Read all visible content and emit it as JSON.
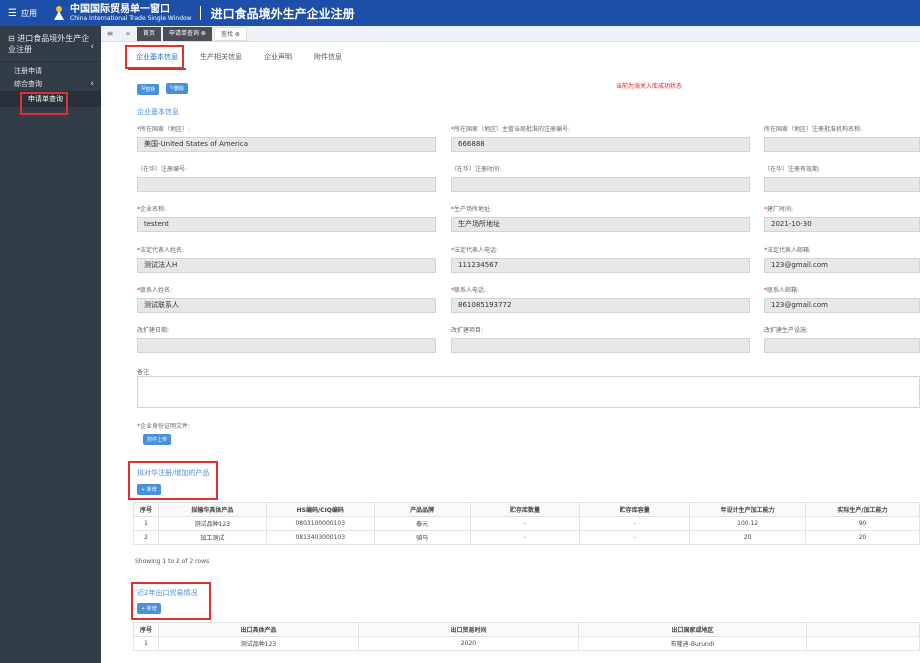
{
  "topbar": {
    "menu_icon": "menu-icon",
    "menu_label": "应用",
    "brand_cn": "中国国际贸易单一窗口",
    "brand_en": "China International Trade Single Window",
    "app_title": "进口食品境外生产企业注册"
  },
  "sidebar": {
    "header": "进口食品境外生产企业注册",
    "items": [
      {
        "label": "注册申请"
      },
      {
        "label": "综合查询"
      }
    ],
    "sub_item": "申请单查询"
  },
  "tabbar": {
    "tabs": [
      "首页",
      "申请单查询 ⊗",
      "查找 ⊗"
    ]
  },
  "subtabs": [
    "企业基本信息",
    "生产相关信息",
    "企业声明",
    "附件信息"
  ],
  "actions": {
    "save": "暂存",
    "delete": "删除"
  },
  "status_text": "当前为海关入库成功状态",
  "basic_section": "企业基本信息",
  "fields": [
    {
      "label": "所在国家（地区）:",
      "required": true,
      "value": "美国-United States of America"
    },
    {
      "label": "所在国家（地区）主管当局批准的注册编号:",
      "required": true,
      "value": "666888"
    },
    {
      "label": "所在国家（地区）注册批准机构名称:",
      "required": false,
      "value": ""
    },
    {
      "label": "（在华）注册编号:",
      "required": false,
      "value": ""
    },
    {
      "label": "（在华）注册时间:",
      "required": false,
      "value": ""
    },
    {
      "label": "（在华）注册有效期:",
      "required": false,
      "value": ""
    },
    {
      "label": "企业名称:",
      "required": true,
      "value": "testent"
    },
    {
      "label": "生产场所地址:",
      "required": true,
      "value": "生产场所地址"
    },
    {
      "label": "建厂时间:",
      "required": true,
      "value": "2021-10-30"
    },
    {
      "label": "法定代表人姓名:",
      "required": true,
      "value": "测试法人H"
    },
    {
      "label": "法定代表人电话:",
      "required": true,
      "value": "111234567"
    },
    {
      "label": "法定代表人邮箱:",
      "required": true,
      "value": "123@gmail.com"
    },
    {
      "label": "联系人姓名:",
      "required": true,
      "value": "测试联系人"
    },
    {
      "label": "联系人电话:",
      "required": true,
      "value": "861085193772"
    },
    {
      "label": "联系人邮箱:",
      "required": true,
      "value": "123@gmail.com"
    },
    {
      "label": "改扩建日期:",
      "required": false,
      "value": ""
    },
    {
      "label": "改扩建项目:",
      "required": false,
      "value": ""
    },
    {
      "label": "改扩建生产设施:",
      "required": false,
      "value": ""
    }
  ],
  "remark_label": "备注",
  "id_file_label": "企业身份证明文件:",
  "upload_btn": "附件上传",
  "products": {
    "title": "拟对华注册/增加的产品",
    "add_btn": "+ 新增",
    "headers": [
      "序号",
      "拟输华具体产品",
      "HS编码/CIQ编码",
      "产品品牌",
      "贮存库数量",
      "贮存库容量",
      "年设计生产加工能力",
      "实际生产/加工能力"
    ],
    "rows": [
      [
        "1",
        "测试品种123",
        "0803100000103",
        "泰元",
        "-",
        "-",
        "100.12",
        "90"
      ],
      [
        "2",
        "加工测试",
        "0813403000103",
        "骑马",
        "-",
        "-",
        "20",
        "20"
      ]
    ],
    "showing": "Showing 1 to 2 of 2 rows"
  },
  "trade": {
    "title": "近2年出口贸易情况",
    "add_btn": "+ 新增",
    "headers": [
      "序号",
      "出口具体产品",
      "出口贸易时间",
      "出口国家或地区"
    ],
    "rows": [
      [
        "1",
        "测试品种123",
        "2020",
        "布隆迪-Burundi"
      ]
    ]
  },
  "colors": {
    "brand": "#1e4fa8",
    "sidebar": "#333d4a",
    "accent": "#4a90d9",
    "highlight": "#e03030"
  }
}
